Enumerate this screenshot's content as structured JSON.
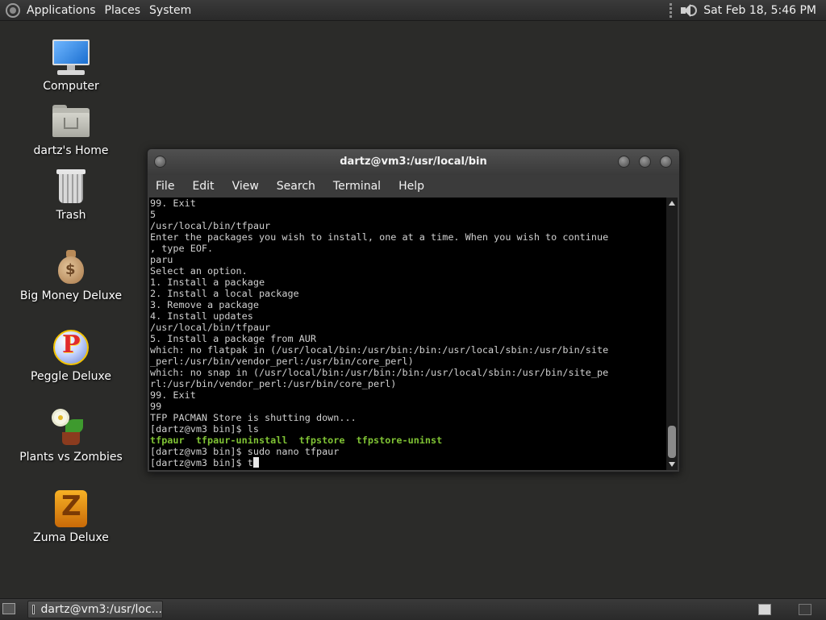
{
  "top_panel": {
    "menus": [
      "Applications",
      "Places",
      "System"
    ],
    "clock": "Sat Feb 18,  5:46 PM",
    "volume_icon": "volume-icon"
  },
  "desktop": {
    "icons": [
      {
        "label": "Computer",
        "icon": "computer-icon"
      },
      {
        "label": "dartz's Home",
        "icon": "home-folder-icon"
      },
      {
        "label": "Trash",
        "icon": "trash-icon"
      },
      {
        "label": "Big Money Deluxe",
        "icon": "money-bag-icon"
      },
      {
        "label": "Peggle Deluxe",
        "icon": "peggle-icon"
      },
      {
        "label": "Plants vs Zombies",
        "icon": "plants-icon"
      },
      {
        "label": "Zuma Deluxe",
        "icon": "zuma-icon"
      }
    ]
  },
  "window": {
    "title": "dartz@vm3:/usr/local/bin",
    "menus": [
      "File",
      "Edit",
      "View",
      "Search",
      "Terminal",
      "Help"
    ],
    "terminal_lines": [
      "99. Exit",
      "5",
      "/usr/local/bin/tfpaur",
      "Enter the packages you wish to install, one at a time. When you wish to continue",
      ", type EOF.",
      "paru",
      "Select an option.",
      "1. Install a package",
      "2. Install a local package",
      "3. Remove a package",
      "4. Install updates",
      "/usr/local/bin/tfpaur",
      "5. Install a package from AUR",
      "which: no flatpak in (/usr/local/bin:/usr/bin:/bin:/usr/local/sbin:/usr/bin/site",
      "_perl:/usr/bin/vendor_perl:/usr/bin/core_perl)",
      "which: no snap in (/usr/local/bin:/usr/bin:/bin:/usr/local/sbin:/usr/bin/site_pe",
      "rl:/usr/bin/vendor_perl:/usr/bin/core_perl)",
      "99. Exit",
      "99",
      "TFP PACMAN Store is shutting down...",
      "[dartz@vm3 bin]$ ls"
    ],
    "ls_output": "tfpaur  tfpaur-uninstall  tfpstore  tfpstore-uninst",
    "line_after_ls": "[dartz@vm3 bin]$ sudo nano tfpaur",
    "prompt": "[dartz@vm3 bin]$ ",
    "current_input": "t"
  },
  "bottom_panel": {
    "task_label": "dartz@vm3:/usr/loc..."
  }
}
